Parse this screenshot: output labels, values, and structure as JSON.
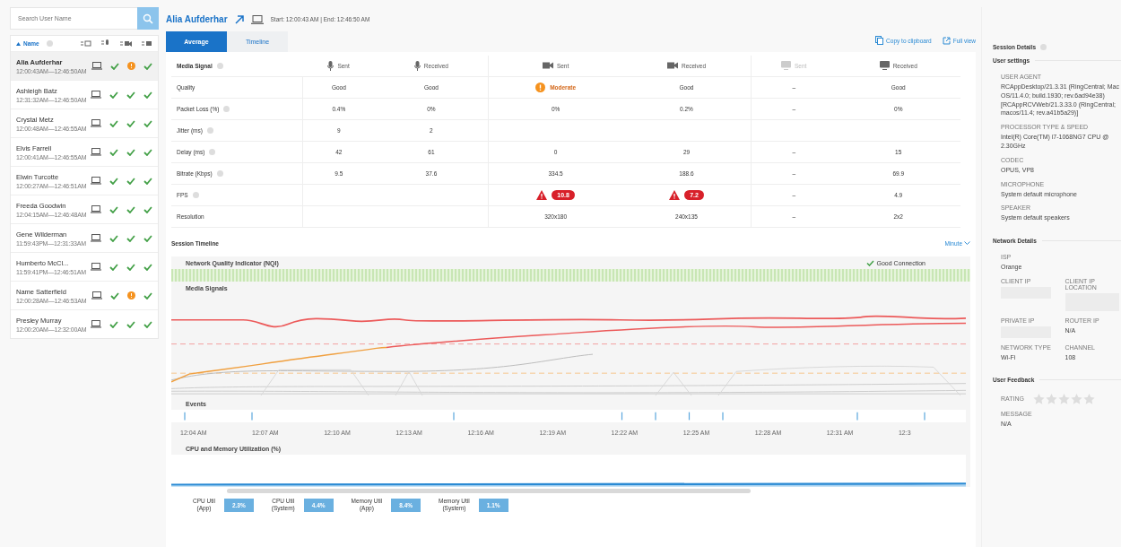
{
  "search": {
    "placeholder": "Search User Name"
  },
  "user_list": {
    "sort_label": "Name",
    "users": [
      {
        "name": "Alia Aufderhar",
        "time": "12:00:43AM—12:46:50AM",
        "selected": true,
        "audio_warning": false,
        "video_warning": true,
        "screen_warning": false
      },
      {
        "name": "Ashleigh Batz",
        "time": "12:31:32AM—12:46:50AM",
        "selected": false,
        "audio_warning": false,
        "video_warning": false,
        "screen_warning": false
      },
      {
        "name": "Crystal Metz",
        "time": "12:00:48AM—12:46:55AM",
        "selected": false,
        "audio_warning": false,
        "video_warning": false,
        "screen_warning": false
      },
      {
        "name": "Elvis Farrell",
        "time": "12:00:41AM—12:46:55AM",
        "selected": false,
        "audio_warning": false,
        "video_warning": false,
        "screen_warning": false
      },
      {
        "name": "Elwin Turcotte",
        "time": "12:00:27AM—12:46:51AM",
        "selected": false,
        "audio_warning": false,
        "video_warning": false,
        "screen_warning": false
      },
      {
        "name": "Freeda Goodwin",
        "time": "12:04:15AM—12:46:48AM",
        "selected": false,
        "audio_warning": false,
        "video_warning": false,
        "screen_warning": false
      },
      {
        "name": "Gene Wilderman",
        "time": "11:59:43PM—12:31:33AM",
        "selected": false,
        "audio_warning": false,
        "video_warning": false,
        "screen_warning": false
      },
      {
        "name": "Humberto McCl...",
        "time": "11:59:41PM—12:46:51AM",
        "selected": false,
        "audio_warning": false,
        "video_warning": false,
        "screen_warning": false
      },
      {
        "name": "Name Satterfield",
        "time": "12:00:28AM—12:46:53AM",
        "selected": false,
        "audio_warning": false,
        "video_warning": true,
        "screen_warning": false
      },
      {
        "name": "Presley Murray",
        "time": "12:00:20AM—12:32:00AM",
        "selected": false,
        "audio_warning": false,
        "video_warning": false,
        "screen_warning": false
      }
    ]
  },
  "header": {
    "user": "Alia Aufderhar",
    "times": "Start: 12:00:43 AM | End: 12:46:50 AM"
  },
  "tabs": [
    {
      "label": "Average",
      "selected": true
    },
    {
      "label": "Timeline",
      "selected": false
    }
  ],
  "actions": [
    "Copy to clipboard",
    "Full view"
  ],
  "media_table": {
    "title": "Media Signal",
    "columns": [
      {
        "kind": "mic",
        "label": "Sent",
        "disabled": false
      },
      {
        "kind": "mic",
        "label": "Received",
        "disabled": false
      },
      {
        "kind": "video",
        "label": "Sent",
        "disabled": false
      },
      {
        "kind": "video",
        "label": "Received",
        "disabled": false
      },
      {
        "kind": "screen",
        "label": "Sent",
        "disabled": true
      },
      {
        "kind": "screen",
        "label": "Received",
        "disabled": false
      }
    ],
    "rows": [
      {
        "label": "Quality",
        "info": false,
        "cells": [
          {
            "text": "Good",
            "kind": "plain"
          },
          {
            "text": "Good",
            "kind": "plain"
          },
          {
            "text": "Moderate",
            "kind": "moderate"
          },
          {
            "text": "Good",
            "kind": "plain"
          },
          {
            "text": "–",
            "kind": "plain"
          },
          {
            "text": "Good",
            "kind": "plain"
          }
        ]
      },
      {
        "label": "Packet Loss (%)",
        "info": true,
        "cells": [
          {
            "text": "0.4%",
            "kind": "plain"
          },
          {
            "text": "0%",
            "kind": "plain"
          },
          {
            "text": "0%",
            "kind": "plain"
          },
          {
            "text": "0.2%",
            "kind": "plain"
          },
          {
            "text": "–",
            "kind": "plain"
          },
          {
            "text": "0%",
            "kind": "plain"
          }
        ]
      },
      {
        "label": "Jitter (ms)",
        "info": true,
        "cells": [
          {
            "text": "9",
            "kind": "plain"
          },
          {
            "text": "2",
            "kind": "plain"
          },
          null,
          null,
          null,
          null
        ]
      },
      {
        "label": "Delay (ms)",
        "info": true,
        "cells": [
          {
            "text": "42",
            "kind": "plain"
          },
          {
            "text": "61",
            "kind": "plain"
          },
          {
            "text": "0",
            "kind": "plain"
          },
          {
            "text": "29",
            "kind": "plain"
          },
          {
            "text": "–",
            "kind": "plain"
          },
          {
            "text": "15",
            "kind": "plain"
          }
        ]
      },
      {
        "label": "Bitrate (Kbps)",
        "info": true,
        "cells": [
          {
            "text": "9.5",
            "kind": "plain"
          },
          {
            "text": "37.6",
            "kind": "plain"
          },
          {
            "text": "334.5",
            "kind": "plain"
          },
          {
            "text": "188.6",
            "kind": "plain"
          },
          {
            "text": "–",
            "kind": "plain"
          },
          {
            "text": "69.9",
            "kind": "plain"
          }
        ]
      },
      {
        "label": "FPS",
        "info": true,
        "cells": [
          null,
          null,
          {
            "text": "10.8",
            "kind": "alert"
          },
          {
            "text": "7.2",
            "kind": "alert"
          },
          {
            "text": "–",
            "kind": "plain"
          },
          {
            "text": "4.9",
            "kind": "plain"
          }
        ]
      },
      {
        "label": "Resolution",
        "info": false,
        "cells": [
          null,
          null,
          {
            "text": "320x180",
            "kind": "plain"
          },
          {
            "text": "240x135",
            "kind": "plain"
          },
          {
            "text": "–",
            "kind": "plain"
          },
          {
            "text": "2x2",
            "kind": "plain"
          }
        ]
      }
    ]
  },
  "session_timeline": {
    "title": "Session Timeline",
    "interval": "Minute",
    "nqi_title": "Network Quality Indicator (NQI)",
    "nqi_status": "Good Connection",
    "media_title": "Media Signals",
    "events_title": "Events",
    "time_labels": [
      "12:04 AM",
      "12:07 AM",
      "12:10 AM",
      "12:13 AM",
      "12:16 AM",
      "12:19 AM",
      "12:22 AM",
      "12:25 AM",
      "12:28 AM",
      "12:31 AM",
      "12:3"
    ],
    "cpu_title": "CPU and Memory Utilization (%)",
    "stats": [
      {
        "label": "CPU Util\n(App)",
        "value": "2.3%"
      },
      {
        "label": "CPU Util\n(System)",
        "value": "4.4%"
      },
      {
        "label": "Memory Util\n(App)",
        "value": "8.4%"
      },
      {
        "label": "Memory Util\n(System)",
        "value": "1.1%"
      }
    ]
  },
  "session_details": {
    "title": "Session Details",
    "user_settings": {
      "title": "User settings",
      "fields": [
        {
          "label": "USER AGENT",
          "value": "RCAppDesktop/21.3.31 (RingCentral; Mac OS/11.4.0; build.1930; rev.6ad94e38) [RCAppRCVWeb/21.3.33.0 (RingCentral; macos/11.4; rev.a41b5a29)]"
        },
        {
          "label": "PROCESSOR TYPE & SPEED",
          "value": "Intel(R) Core(TM) i7-1068NG7 CPU @ 2.30GHz"
        },
        {
          "label": "CODEC",
          "value": "OPUS, VP8"
        },
        {
          "label": "MICROPHONE",
          "value": "System default microphone"
        },
        {
          "label": "SPEAKER",
          "value": "System default speakers"
        }
      ]
    },
    "network": {
      "title": "Network Details",
      "isp_label": "ISP",
      "isp": "Orange",
      "fields": [
        {
          "label": "CLIENT IP"
        },
        {
          "label": "CLIENT IP LOCATION"
        },
        {
          "label": "PRIVATE IP"
        },
        {
          "label": "ROUTER IP",
          "value": "N/A"
        },
        {
          "label": "NETWORK TYPE",
          "value": "Wi-Fi"
        },
        {
          "label": "CHANNEL",
          "value": "108"
        }
      ]
    },
    "feedback": {
      "title": "User Feedback",
      "rating_label": "RATING",
      "stars": 0,
      "message_label": "MESSAGE",
      "message": "N/A"
    }
  }
}
